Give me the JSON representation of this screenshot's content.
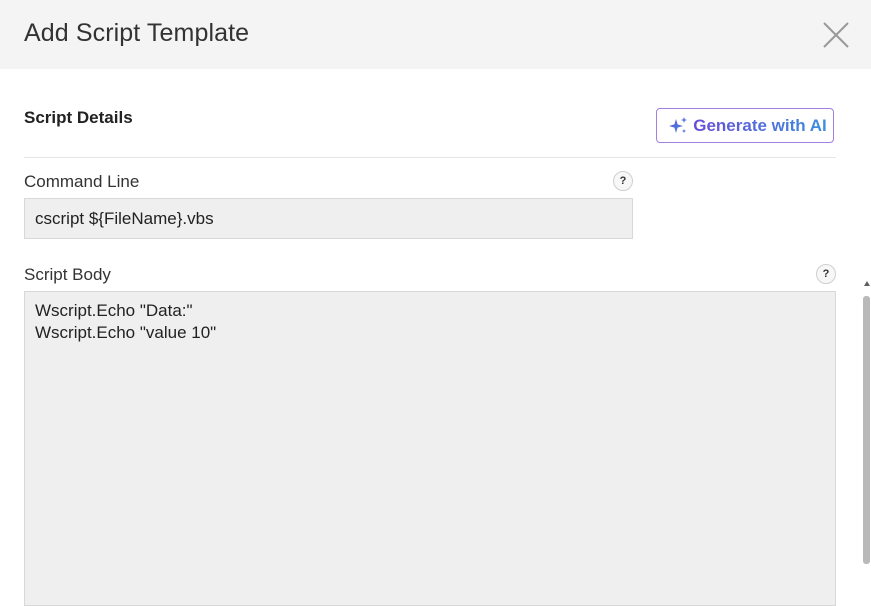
{
  "dialog": {
    "title": "Add Script Template",
    "close_icon": "close-icon"
  },
  "section": {
    "title": "Script Details",
    "ai_button_label": "Generate with AI",
    "ai_icon": "sparkle-icon"
  },
  "fields": {
    "command_line": {
      "label": "Command Line",
      "value": "cscript ${FileName}.vbs",
      "help": "?"
    },
    "script_body": {
      "label": "Script Body",
      "value": "Wscript.Echo \"Data:\"\nWscript.Echo \"value 10\"",
      "help": "?"
    }
  },
  "colors": {
    "header_bg": "#f4f4f4",
    "field_bg": "#efefef",
    "ai_border": "#a27fe0",
    "ai_gradient_start": "#6a4cd6",
    "ai_gradient_end": "#3a8fe0"
  }
}
